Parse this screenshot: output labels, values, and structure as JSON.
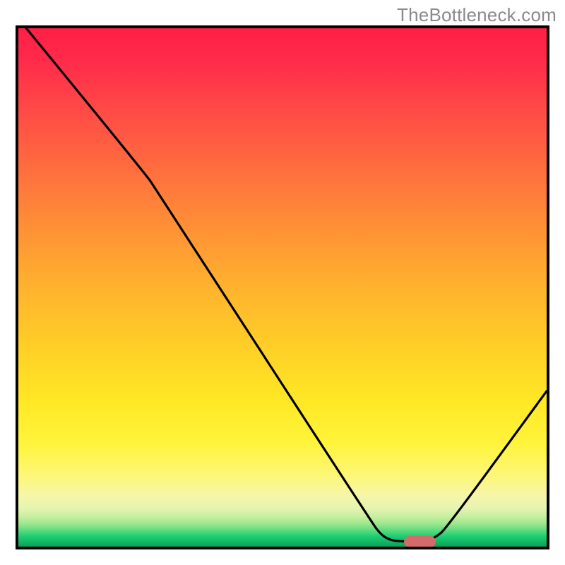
{
  "watermark": "TheBottleneck.com",
  "chart_data": {
    "type": "line",
    "title": "",
    "xlabel": "",
    "ylabel": "",
    "xlim": [
      0,
      100
    ],
    "ylim": [
      0,
      100
    ],
    "grid": false,
    "legend": false,
    "series": [
      {
        "name": "curve",
        "color": "#000000",
        "points": [
          {
            "x": 1.5,
            "y": 100
          },
          {
            "x": 24,
            "y": 72
          },
          {
            "x": 26,
            "y": 69
          },
          {
            "x": 67,
            "y": 4.5
          },
          {
            "x": 68.5,
            "y": 2.5
          },
          {
            "x": 70,
            "y": 1.4
          },
          {
            "x": 72,
            "y": 1
          },
          {
            "x": 77,
            "y": 1
          },
          {
            "x": 79,
            "y": 1.8
          },
          {
            "x": 81,
            "y": 3.5
          },
          {
            "x": 100,
            "y": 30
          }
        ]
      }
    ],
    "marker": {
      "x_center": 76,
      "y": 1,
      "width_pct": 6,
      "color": "#d36a6c"
    }
  },
  "layout": {
    "plot_inner_w": 748,
    "plot_inner_h": 734
  }
}
